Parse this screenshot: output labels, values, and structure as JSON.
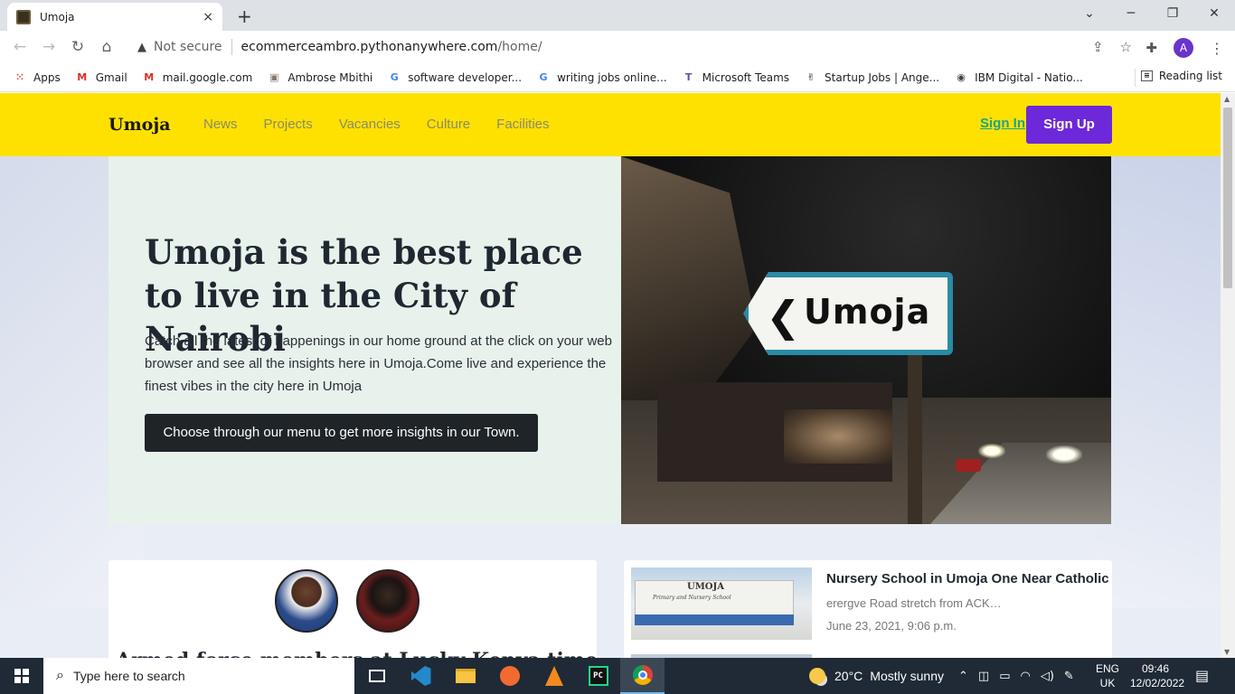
{
  "browser": {
    "tab_title": "Umoja",
    "new_tab": "+",
    "tab_close": "×",
    "window_controls": {
      "minimize": "─",
      "restore": "❐",
      "close": "✕"
    },
    "nav": {
      "back": "←",
      "forward": "→",
      "reload": "↻",
      "home": "⌂"
    },
    "security_label": "Not secure",
    "url_host": "ecommerceambro.pythonanywhere.com",
    "url_path": "/home/",
    "avatar_letter": "A",
    "bookmarks": [
      {
        "label": "Apps",
        "icon": "apps-grid-icon",
        "color": "#e94235"
      },
      {
        "label": "Gmail",
        "icon": "gmail-icon",
        "color": "#d93025"
      },
      {
        "label": "mail.google.com",
        "icon": "gmail-icon",
        "color": "#d93025"
      },
      {
        "label": "Ambrose Mbithi",
        "icon": "profile-photo-icon",
        "color": "#8a7a6a"
      },
      {
        "label": "software developer...",
        "icon": "google-icon",
        "color": "#4285f4"
      },
      {
        "label": "writing jobs online...",
        "icon": "google-icon",
        "color": "#4285f4"
      },
      {
        "label": "Microsoft Teams",
        "icon": "teams-icon",
        "color": "#5558af"
      },
      {
        "label": "Startup Jobs | Ange...",
        "icon": "angellist-icon",
        "color": "#222222"
      },
      {
        "label": "IBM Digital - Natio...",
        "icon": "globe-icon",
        "color": "#444444"
      }
    ],
    "reading_list": "Reading list"
  },
  "site": {
    "brand": "Umoja",
    "menu": [
      "News",
      "Projects",
      "Vacancies",
      "Culture",
      "Facilities"
    ],
    "sign_in": "Sign In",
    "sign_up": "Sign Up",
    "hero": {
      "title": "Umoja is the best place to live in the City of Nairobi",
      "text": "Catch all the latest of happenings in our home ground at the click on your web browser and see all the insights here in Umoja.Come live and experience the finest vibes in the city here in Umoja",
      "button": "Choose through our menu to get more insights in our Town.",
      "image_sign_text": "Umoja"
    },
    "featured_partial_title": "Armed force members at Lucky Kenya time",
    "news": [
      {
        "title": "Nursery School in Umoja One Near Catholic",
        "excerpt": "erergve Road stretch from ACK…",
        "date": "June 23, 2021, 9:06 p.m.",
        "thumb_title": "UMOJA",
        "thumb_sub": "Primary and Nursery School"
      }
    ]
  },
  "taskbar": {
    "search_placeholder": "Type here to search",
    "weather_temp": "20°C",
    "weather_desc": "Mostly sunny",
    "lang_line1": "ENG",
    "lang_line2": "UK",
    "time": "09:46",
    "date": "12/02/2022"
  },
  "colors": {
    "nav_yellow": "#ffe100",
    "signup_purple": "#6d28d9",
    "signin_teal": "#1aa390",
    "hero_panel": "#e6f2eb",
    "dark_button": "#1f2428"
  }
}
